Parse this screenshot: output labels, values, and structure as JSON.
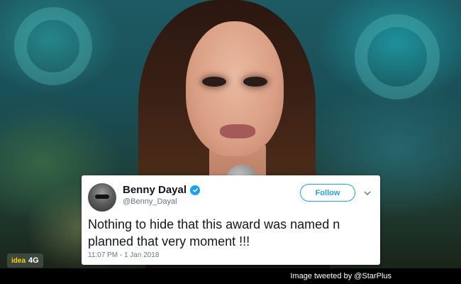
{
  "tweet": {
    "display_name": "Benny Dayal",
    "handle": "@Benny_Dayal",
    "follow_label": "Follow",
    "text": "Nothing to hide that this award was named n planned that very moment !!!",
    "timestamp": "11:07 PM - 1 Jan 2018",
    "verified": true,
    "avatar_icon": "avatar-photo",
    "verified_icon": "verified-badge-icon",
    "more_icon": "chevron-down-icon"
  },
  "caption": {
    "text": "Image tweeted by @StarPlus"
  },
  "broadcast_logo": {
    "brand": "idea",
    "network": "4G"
  },
  "colors": {
    "twitter_blue": "#1da1f2",
    "text_primary": "#14171a",
    "text_secondary": "#657786",
    "caption_bg": "#000000",
    "card_bg": "#ffffff"
  }
}
